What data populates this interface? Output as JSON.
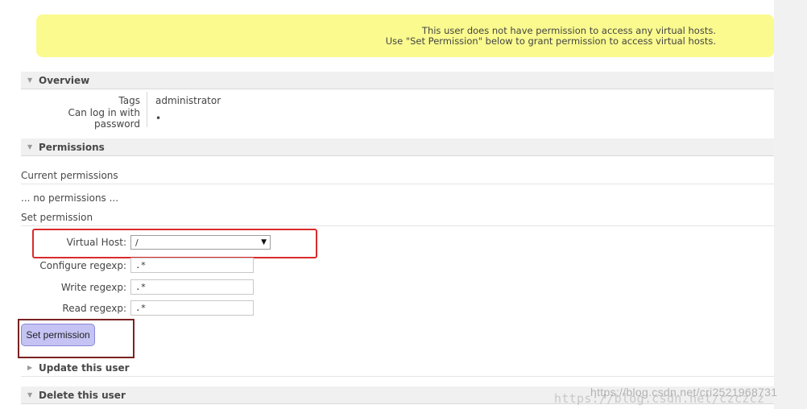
{
  "notice": {
    "line1": "This user does not have permission to access any virtual hosts.",
    "line2": "Use \"Set Permission\" below to grant permission to access virtual hosts."
  },
  "overview": {
    "title": "Overview",
    "tags_label": "Tags",
    "tags_value": "administrator",
    "login_label": "Can log in with password",
    "login_value": "•"
  },
  "permissions": {
    "title": "Permissions",
    "current_label": "Current permissions",
    "none_text": "... no permissions ...",
    "set_label": "Set permission",
    "vhost_label": "Virtual Host:",
    "vhost_value": "/",
    "configure_label": "Configure regexp:",
    "configure_value": ".*",
    "write_label": "Write regexp:",
    "write_value": ".*",
    "read_label": "Read regexp:",
    "read_value": ".*",
    "button_label": "Set permission"
  },
  "update_section": {
    "title": "Update this user"
  },
  "delete_section": {
    "title": "Delete this user"
  },
  "watermark": {
    "back": "https://blog.csdn.net/czczcz",
    "front": "https://blog.csdn.net/cri2521968731"
  },
  "colors": {
    "notice_bg": "#fafa8f",
    "button_bg": "#c5c3f4",
    "highlight_red": "#d92b2b",
    "highlight_brown": "#7a2222"
  }
}
